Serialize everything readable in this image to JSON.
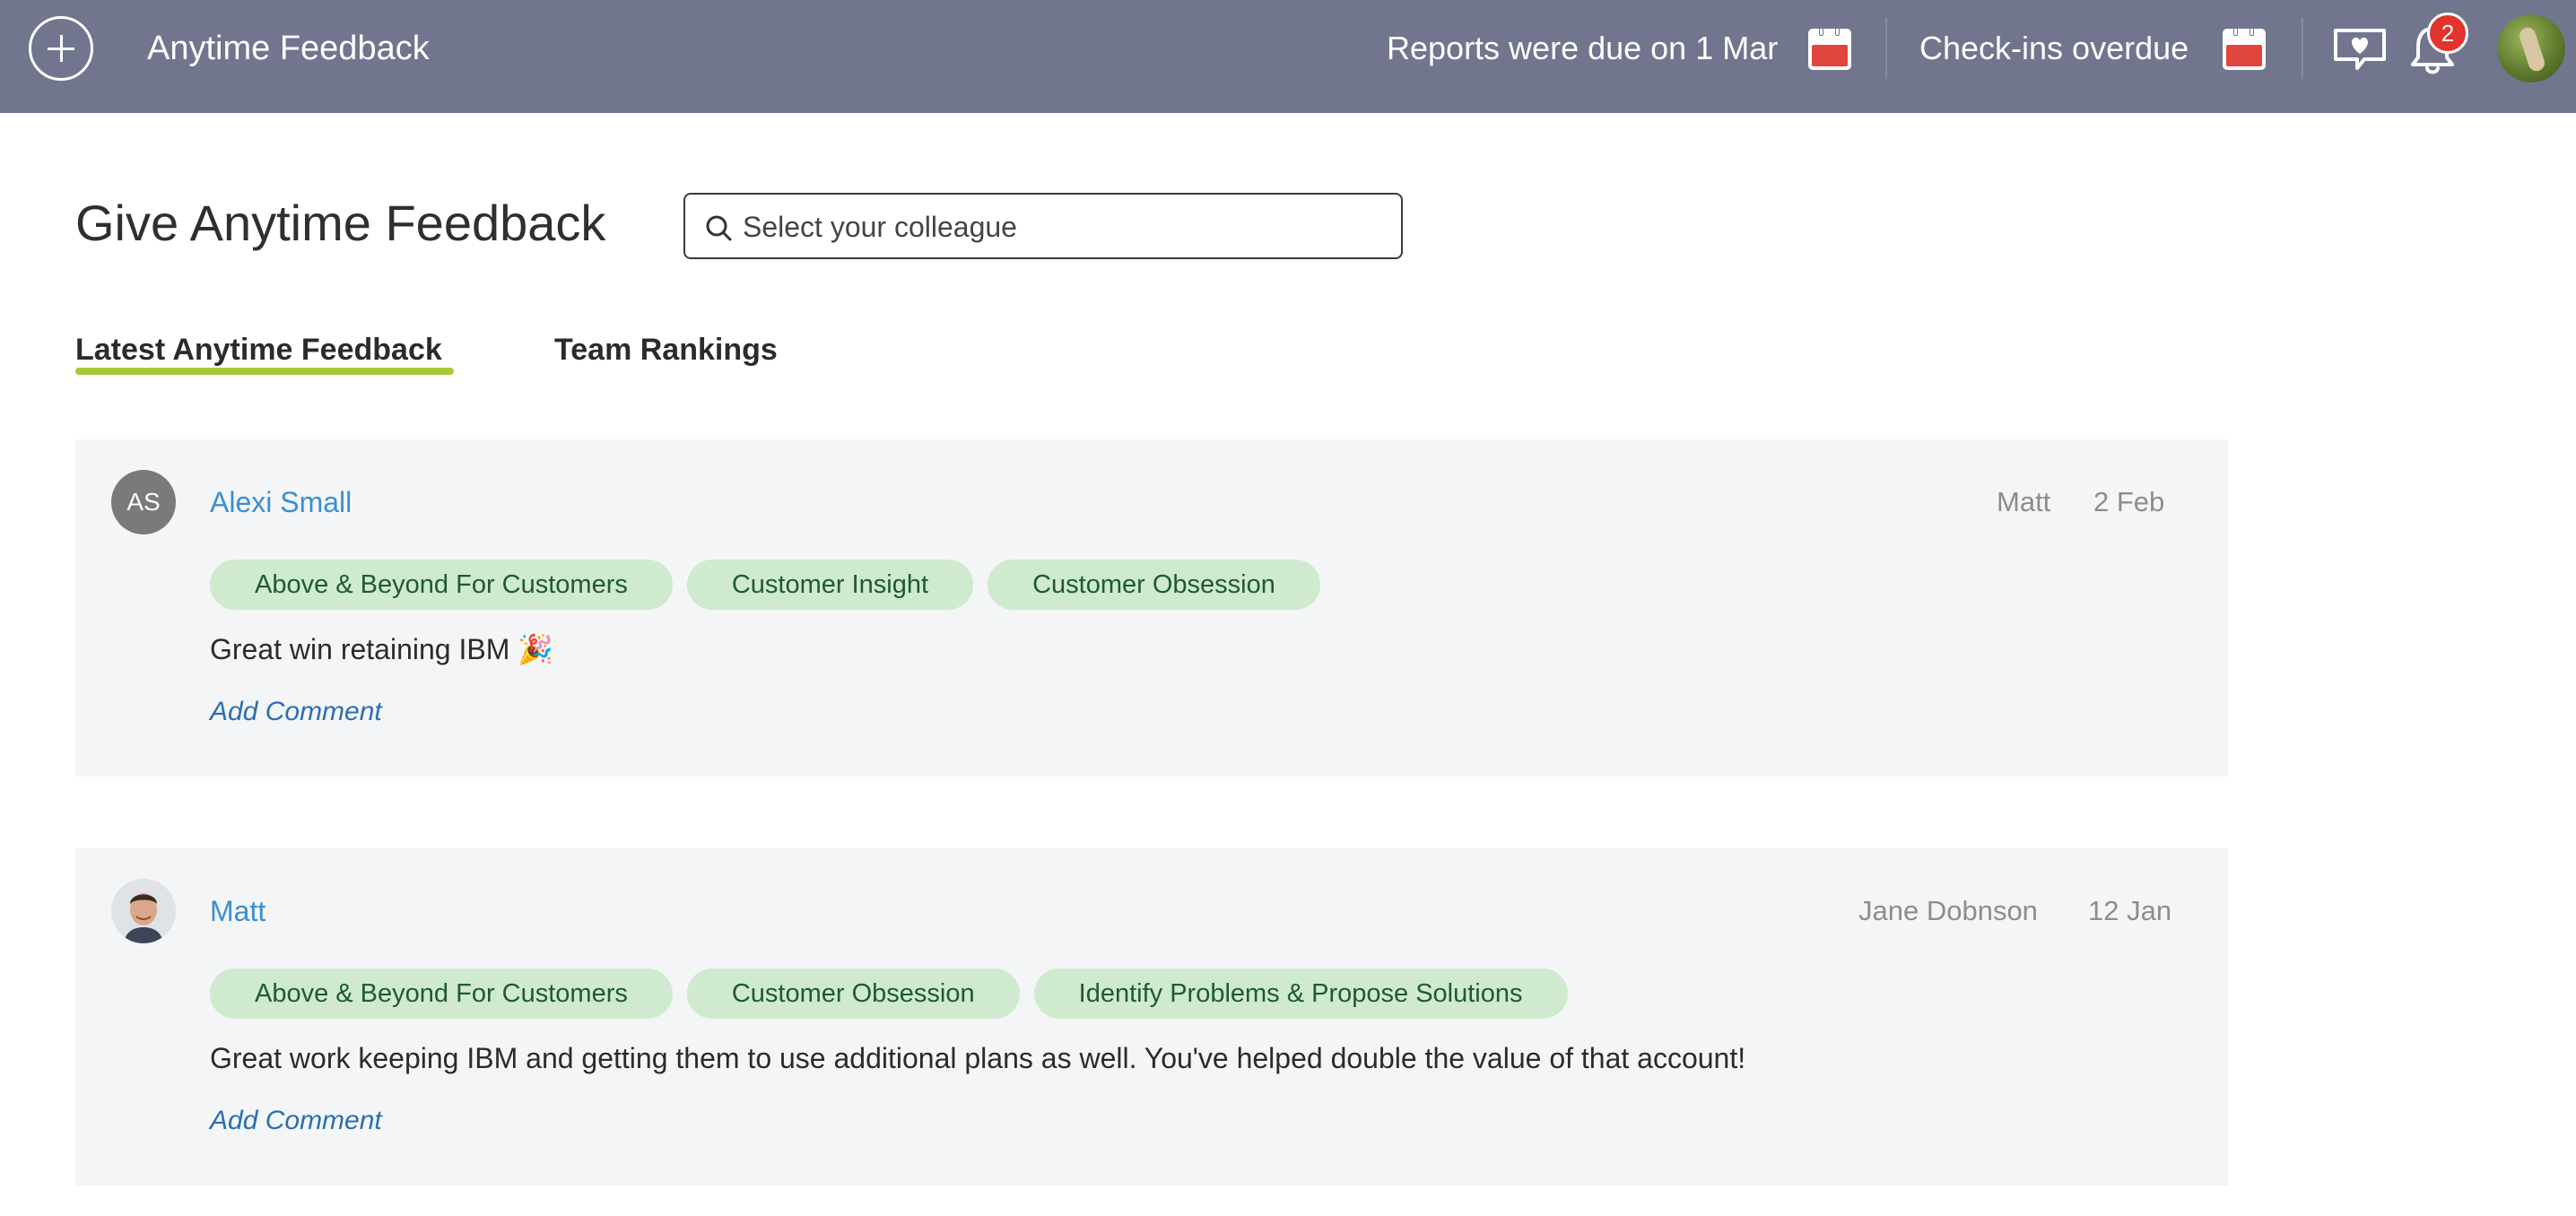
{
  "header": {
    "title": "Anytime Feedback",
    "reports_status": "Reports were due on 1 Mar",
    "checkins_status": "Check-ins overdue",
    "notification_count": "2",
    "icons": [
      "add-icon",
      "calendar-icon",
      "calendar-icon",
      "feedback-heart-icon",
      "bell-icon",
      "user-avatar"
    ]
  },
  "main": {
    "title": "Give Anytime Feedback",
    "search": {
      "placeholder": "Select your colleague",
      "value": ""
    },
    "tabs": [
      {
        "label": "Latest Anytime Feedback",
        "active": true
      },
      {
        "label": "Team Rankings",
        "active": false
      }
    ]
  },
  "feedback": [
    {
      "recipient": "Alexi Small",
      "initials": "AS",
      "giver": "Matt",
      "date": "2 Feb",
      "tags": [
        "Above & Beyond For Customers",
        "Customer Insight",
        "Customer Obsession"
      ],
      "message": "Great win retaining IBM 🎉",
      "add_comment": "Add Comment"
    },
    {
      "recipient": "Matt",
      "giver": "Jane Dobnson",
      "date": "12 Jan",
      "tags": [
        "Above & Beyond For Customers",
        "Customer Obsession",
        "Identify Problems & Propose Solutions"
      ],
      "message": "Great work keeping IBM and getting them to use additional plans as well. You've helped double the value of that account!",
      "add_comment": "Add Comment"
    }
  ],
  "colors": {
    "topbar": "#72758e",
    "accent_underline": "#a6c93a",
    "tag_bg": "#cfeacf",
    "tag_text": "#1f5a32",
    "link": "#3a8fd0",
    "badge": "#e2332d",
    "calendar_red": "#e2453d"
  }
}
